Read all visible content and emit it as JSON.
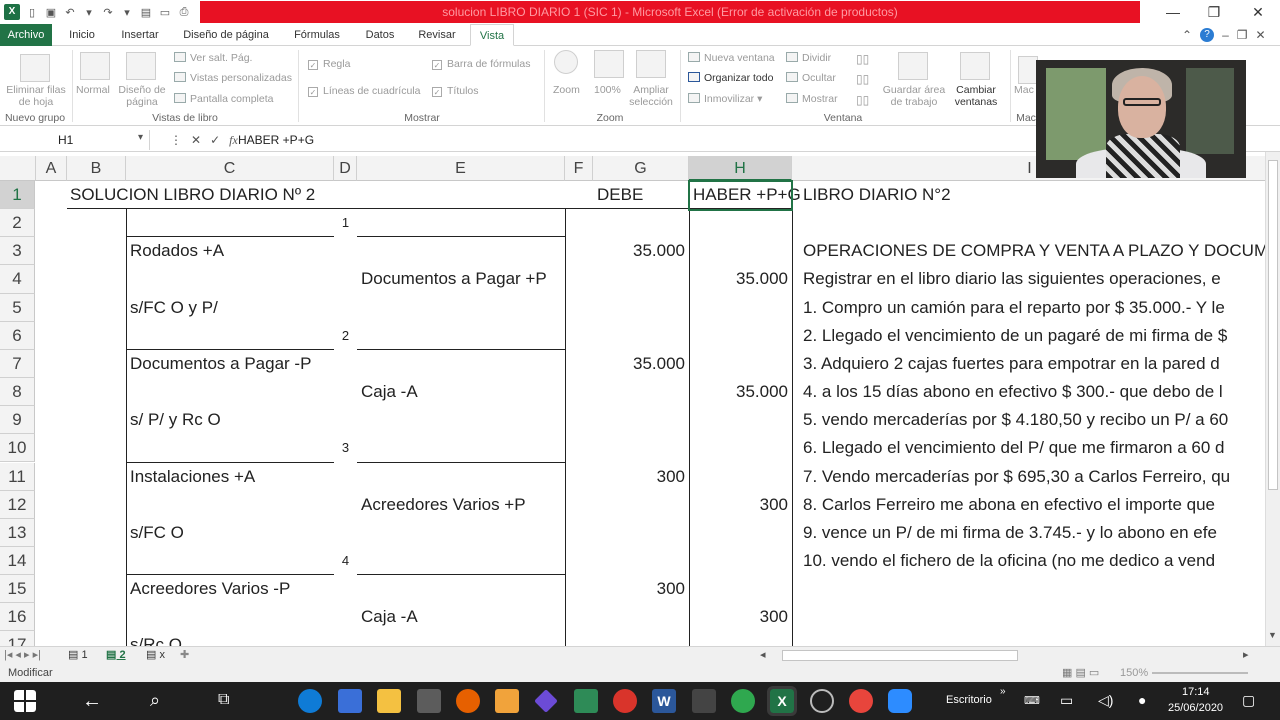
{
  "window": {
    "title": "solucion LIBRO DIARIO 1 (SIC 1) - Microsoft Excel (Error de activación de productos)",
    "minimize": "—",
    "maximize": "❐",
    "close": "✕"
  },
  "tabs": [
    "Archivo",
    "Inicio",
    "Insertar",
    "Diseño de página",
    "Fórmulas",
    "Datos",
    "Revisar",
    "Vista"
  ],
  "active_tab": "Vista",
  "ribbon": {
    "eliminar_filas": "Eliminar filas de hoja",
    "nuevo_grupo": "Nuevo grupo",
    "normal": "Normal",
    "diseno_pagina": "Diseño de página",
    "ver_salt_pag": "Ver salt. Pág.",
    "vistas_personalizadas": "Vistas personalizadas",
    "pantalla_completa": "Pantalla completa",
    "vistas_libro": "Vistas de libro",
    "regla": "Regla",
    "lineas_cuadricula": "Líneas de cuadrícula",
    "barra_formulas": "Barra de fórmulas",
    "titulos": "Títulos",
    "mostrar": "Mostrar",
    "zoom": "Zoom",
    "zoom_100": "100%",
    "ampliar_seleccion": "Ampliar selección",
    "zoom_group": "Zoom",
    "nueva_ventana": "Nueva ventana",
    "organizar_todo": "Organizar todo",
    "inmovilizar": "Inmovilizar",
    "dividir": "Dividir",
    "ocultar": "Ocultar",
    "mostrar_btn": "Mostrar",
    "guardar_area": "Guardar área de trabajo",
    "cambiar_ventanas": "Cambiar ventanas",
    "ventana": "Ventana",
    "macros": "Mac"
  },
  "formula_bar": {
    "name_box": "H1",
    "content": "HABER +P+G"
  },
  "columns": [
    "A",
    "B",
    "C",
    "D",
    "E",
    "F",
    "G",
    "H",
    "I"
  ],
  "rows": [
    "1",
    "2",
    "3",
    "4",
    "5",
    "6",
    "7",
    "8",
    "9",
    "10",
    "11",
    "12",
    "13",
    "14",
    "15",
    "16",
    "17"
  ],
  "cells": {
    "B1": "SOLUCION LIBRO DIARIO Nº 2",
    "G1": "DEBE",
    "H1": "HABER +P+G",
    "I1": "LIBRO DIARIO N°2",
    "D2": "1",
    "C3": "Rodados +A",
    "G3": "35.000",
    "E4": "Documentos a Pagar +P",
    "H4": "35.000",
    "C5": "s/FC O y P/",
    "D6": "2",
    "C7": "Documentos a Pagar -P",
    "G7": "35.000",
    "E8": "Caja -A",
    "H8": "35.000",
    "C9": "s/ P/ y Rc O",
    "D10": "3",
    "C11": "Instalaciones +A",
    "G11": "300",
    "E12": "Acreedores Varios +P",
    "H12": "300",
    "C13": "s/FC O",
    "D14": "4",
    "C15": "Acreedores Varios -P",
    "G15": "300",
    "E16": "Caja -A",
    "H16": "300",
    "C17": "s/Rc O",
    "I3": "OPERACIONES DE COMPRA Y VENTA A PLAZO Y DOCUMENTOS",
    "I4": "Registrar en el libro diario las siguientes operaciones, e",
    "I5": "1. Compro un camión para el reparto por $ 35.000.- Y le",
    "I6": "2. Llegado el vencimiento de un pagaré de mi firma de $",
    "I7": "3. Adquiero 2 cajas fuertes para empotrar en la pared d",
    "I8": "4. a los 15 días abono en efectivo $ 300.- que debo de l",
    "I9": "5. vendo mercaderías por $ 4.180,50 y recibo un P/ a 60",
    "I10": "6. Llegado el vencimiento del P/ que me firmaron a 60 d",
    "I11": "7. Vendo mercaderías por $ 695,30 a Carlos Ferreiro, qu",
    "I12": "8. Carlos Ferreiro me abona en efectivo el importe que",
    "I13": "9. vence un P/ de mi firma de 3.745.- y lo abono en efe",
    "I14": "10. vendo el fichero de la oficina (no me dedico a vend"
  },
  "sheets": [
    "1",
    "2",
    "x"
  ],
  "active_sheet": "2",
  "status": {
    "mode": "Modificar",
    "zoom": "150%"
  },
  "taskbar": {
    "search_label": "Escritorio",
    "time": "17:14",
    "date": "25/06/2020"
  }
}
